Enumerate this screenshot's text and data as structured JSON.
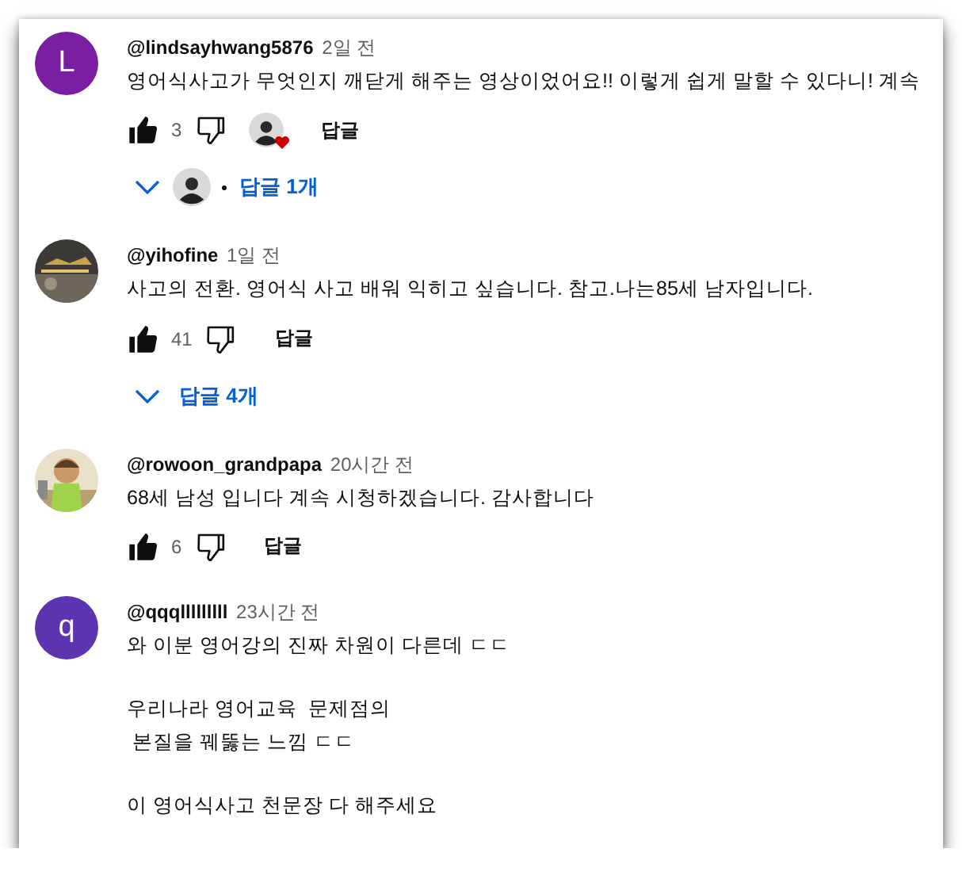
{
  "comments": [
    {
      "avatar": {
        "kind": "letter",
        "letter": "L",
        "color": "#7b1fa2"
      },
      "author": "@lindsayhwang5876",
      "time": "2일 전",
      "text": "영어식사고가 무엇인지 깨닫게 해주는 영상이었어요!! 이렇게 쉽게 말할 수 있다니! 계속",
      "likes": "3",
      "creator_heart": true,
      "reply_button": "답글",
      "replies": {
        "label": "답글 1개",
        "creator_avatar": true
      }
    },
    {
      "author": "@yihofine",
      "time": "1일 전",
      "text": "사고의 전환. 영어식 사고 배워 익히고 싶습니다. 참고.나는85세 남자입니다.",
      "likes": "41",
      "creator_heart": false,
      "reply_button": "답글",
      "replies": {
        "label": "답글 4개",
        "creator_avatar": false
      }
    },
    {
      "author": "@rowoon_grandpapa",
      "time": "20시간 전",
      "text": "68세 남성 입니다 계속 시청하겠습니다. 감사합니다",
      "likes": "6",
      "creator_heart": false,
      "reply_button": "답글"
    },
    {
      "avatar": {
        "kind": "letter",
        "letter": "q",
        "color": "#5e35b1"
      },
      "author": "@qqqlllllllll",
      "time": "23시간 전",
      "text": "와 이분 영어강의 진짜 차원이 다른데 ㄷㄷ\n\n우리나라 영어교육  문제점의\n 본질을 꿰뚫는 느낌 ㄷㄷ\n\n이 영어식사고 천문장 다 해주세요"
    }
  ]
}
